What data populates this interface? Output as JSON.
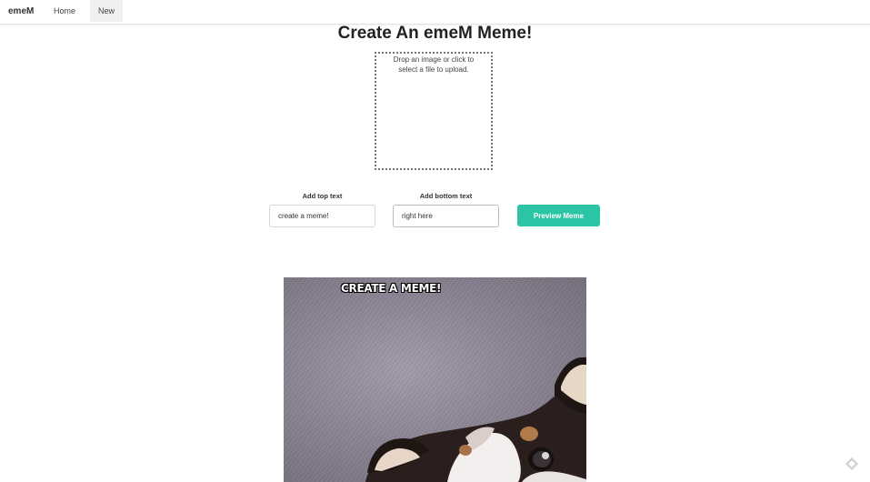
{
  "navbar": {
    "brand": "emeM",
    "links": [
      {
        "label": "Home"
      },
      {
        "label": "New"
      }
    ]
  },
  "page": {
    "title": "Create An emeM Meme!"
  },
  "dropzone": {
    "text": "Drop an image or click to select a file to upload."
  },
  "form": {
    "top_label": "Add top text",
    "top_value": "create a meme!",
    "bottom_label": "Add bottom text",
    "bottom_value": "right here",
    "preview_button": "Preview Meme"
  },
  "meme": {
    "top_text": "CREATE A MEME!",
    "image_subject": "dog-photo"
  },
  "colors": {
    "accent": "#2bc4a4",
    "nav_active_bg": "#f0f0f0"
  },
  "icons": {
    "watermark": "diamond-logo-icon"
  }
}
